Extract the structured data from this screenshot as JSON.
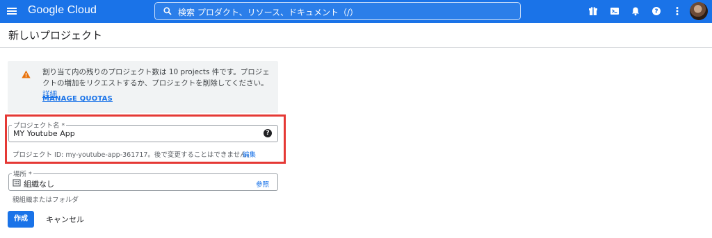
{
  "topbar": {
    "brand": "Google Cloud",
    "search_text": "検索  プロダクト、リソース、ドキュメント（/）",
    "icons": [
      "menu-icon",
      "search-icon",
      "gift-icon",
      "cloud-shell-icon",
      "notifications-icon",
      "help-icon",
      "more-vert-icon",
      "account-avatar"
    ],
    "accent_color": "#1a73e8"
  },
  "page": {
    "title": "新しいプロジェクト"
  },
  "notice": {
    "text": "割り当て内の残りのプロジェクト数は 10 projects 件です。プロジェクトの増加をリクエストするか、プロジェクトを削除してください。",
    "link": "詳細",
    "action": "MANAGE QUOTAS",
    "icon": "warning-icon",
    "warning_color": "#e8710a"
  },
  "project_name": {
    "label": "プロジェクト名 *",
    "value": "MY Youtube App",
    "hint": "プロジェクト ID: my-youtube-app-361717。後で変更することはできません。",
    "edit_link": "編集",
    "highlight_color": "#e53935"
  },
  "location": {
    "label": "場所 *",
    "value": "組織なし",
    "browse_link": "参照",
    "hint": "親組織またはフォルダ"
  },
  "actions": {
    "create": "作成",
    "cancel": "キャンセル"
  }
}
